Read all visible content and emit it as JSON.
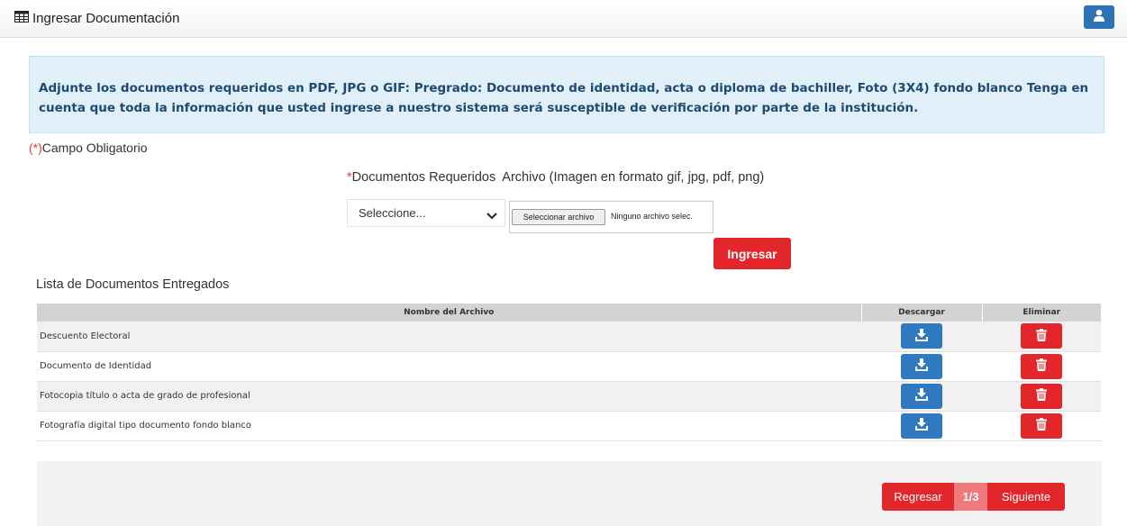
{
  "header": {
    "title": "Ingresar Documentación",
    "icon": "table-grid-icon",
    "user_icon": "user-icon"
  },
  "alert": {
    "text": "Adjunte los documentos requeridos en PDF, JPG o GIF: Pregrado: Documento de identidad, acta o diploma de bachiller, Foto (3X4) fondo blanco Tenga en cuenta que toda la información que usted ingrese a nuestro sistema será susceptible de verificación por parte de la institución."
  },
  "required_note": {
    "marker": "(*)",
    "label": "Campo Obligatorio"
  },
  "form": {
    "required_marker": "*",
    "documents_label": "Documentos Requeridos",
    "file_label": "Archivo (Imagen en formato gif, jpg, pdf, png)",
    "select_value": "Seleccione...",
    "file_button": "Seleccionar archivo",
    "file_status": "Ninguno archivo selec.",
    "submit": "Ingresar"
  },
  "list": {
    "title": "Lista de Documentos Entregados",
    "columns": [
      "Nombre del Archivo",
      "Descargar",
      "Eliminar"
    ],
    "rows": [
      "Descuento Electoral",
      "Documento de Identidad",
      "Fotocopia título o acta de grado de profesional",
      "Fotografía digital tipo documento fondo blanco"
    ]
  },
  "pager": {
    "prev": "Regresar",
    "page": "1/3",
    "next": "Siguiente"
  },
  "colors": {
    "primary_red": "#e3262b",
    "primary_blue": "#2f79c0",
    "alert_bg": "#e1f0f8",
    "alert_text": "#1d4a73"
  }
}
